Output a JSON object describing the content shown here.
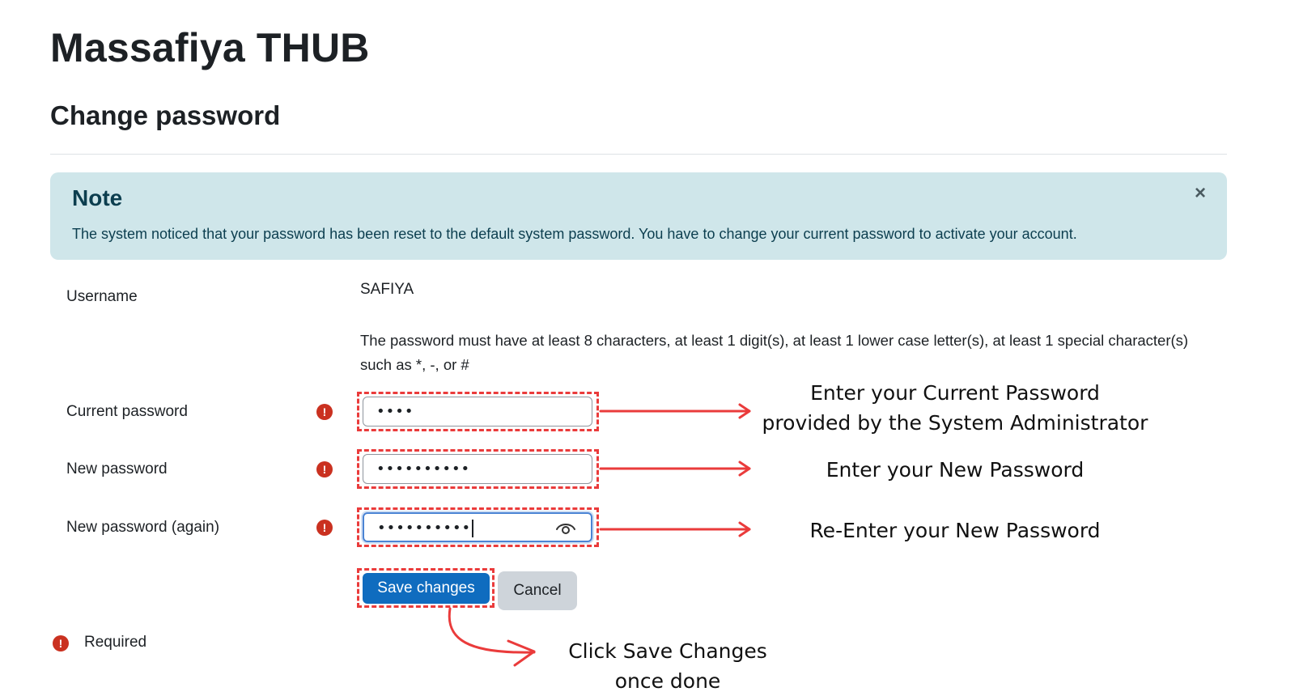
{
  "site": {
    "title": "Massafiya THUB"
  },
  "page": {
    "heading": "Change password"
  },
  "note": {
    "title": "Note",
    "message": "The system noticed that your password has been reset to the default system password. You have to change your current password to activate your account.",
    "close_symbol": "×"
  },
  "form": {
    "username_label": "Username",
    "username_value": "SAFIYA",
    "policy_text": "The password must have at least 8 characters, at least 1 digit(s), at least 1 lower case letter(s), at least 1 special character(s) such as *, -, or #",
    "fields": [
      {
        "label": "Current password",
        "masked_value": "••••"
      },
      {
        "label": "New password",
        "masked_value": "••••••••••"
      },
      {
        "label": "New password (again)",
        "masked_value": "••••••••••"
      }
    ],
    "required_symbol": "!",
    "save_label": "Save changes",
    "cancel_label": "Cancel",
    "required_legend": "Required"
  },
  "annotations": {
    "current_line1": "Enter your Current Password",
    "current_line2": "provided by the System Administrator",
    "new": "Enter your New Password",
    "again": "Re-Enter your New Password",
    "save_line1": "Click Save Changes",
    "save_line2": "once done"
  },
  "icons": [
    "close-icon",
    "required-icon",
    "eye-icon",
    "arrow-icon"
  ],
  "colors": {
    "accent": "#0f6cbf",
    "note_background": "#cfe6ea",
    "required": "#ca3120",
    "annotation_red": "#ea3b3b",
    "focus_border": "#4b84d4"
  }
}
